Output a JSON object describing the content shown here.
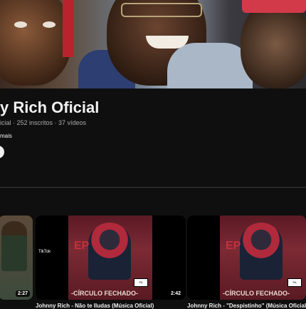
{
  "channel": {
    "name": "y Rich Oficial",
    "meta": "icial · 252 inscritos · 37 vídeos",
    "more": "mais"
  },
  "videos": [
    {
      "duration": "2:27",
      "title": ""
    },
    {
      "duration": "2:42",
      "title": "Johnny Rich - Não te Iludas (Música Oficial)",
      "art_label": "EP",
      "art_caption": "-CÍRCULO FECHADO-",
      "overlay": "TikTok"
    },
    {
      "duration": "",
      "title": "Johnny Rich - \"Despistinho\" (Música Oficial)",
      "art_label": "EP",
      "art_caption": "-CÍRCULO FECHADO-"
    }
  ],
  "colors": {
    "background": "#0f0f0f",
    "text": "#f1f1f1",
    "secondary_text": "#aaaaaa",
    "ep_red": "#c5303e"
  }
}
